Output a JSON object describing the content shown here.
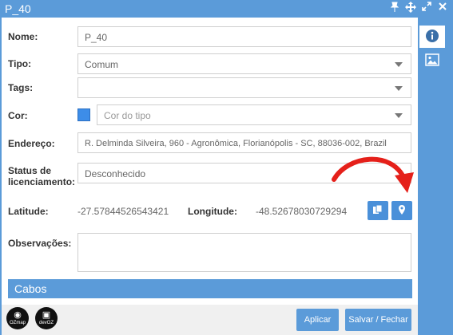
{
  "window": {
    "title": "P_40"
  },
  "form": {
    "nome": {
      "label": "Nome:",
      "value": "P_40"
    },
    "tipo": {
      "label": "Tipo:",
      "value": "Comum"
    },
    "tags": {
      "label": "Tags:",
      "value": ""
    },
    "cor": {
      "label": "Cor:",
      "placeholder": "Cor do tipo",
      "color": "#3d8de8"
    },
    "endereco": {
      "label": "Endereço:",
      "value": "R. Delminda Silveira, 960 - Agronômica, Florianópolis - SC, 88036-002, Brazil"
    },
    "status": {
      "label_line1": "Status de",
      "label_line2": "licenciamento:",
      "value": "Desconhecido"
    },
    "latitude": {
      "label": "Latitude:",
      "value": "-27.57844526543421"
    },
    "longitude": {
      "label": "Longitude:",
      "value": "-48.52678030729294"
    },
    "observacoes": {
      "label": "Observações:",
      "value": ""
    }
  },
  "section": {
    "title": "Cabos"
  },
  "footer": {
    "logo1_text": "OZmap",
    "logo2_text": "devOZ",
    "apply_label": "Aplicar",
    "save_close_label": "Salvar / Fechar"
  },
  "colors": {
    "accent": "#5b9bd9",
    "button": "#4a90d9",
    "arrow": "#e5201a"
  },
  "icons": {
    "window_controls": [
      "pin-icon",
      "move-icon",
      "expand-icon",
      "close-icon"
    ],
    "side_tabs": [
      "info-icon",
      "image-icon"
    ],
    "coord_buttons": [
      "copy-icon",
      "map-pin-icon"
    ]
  }
}
